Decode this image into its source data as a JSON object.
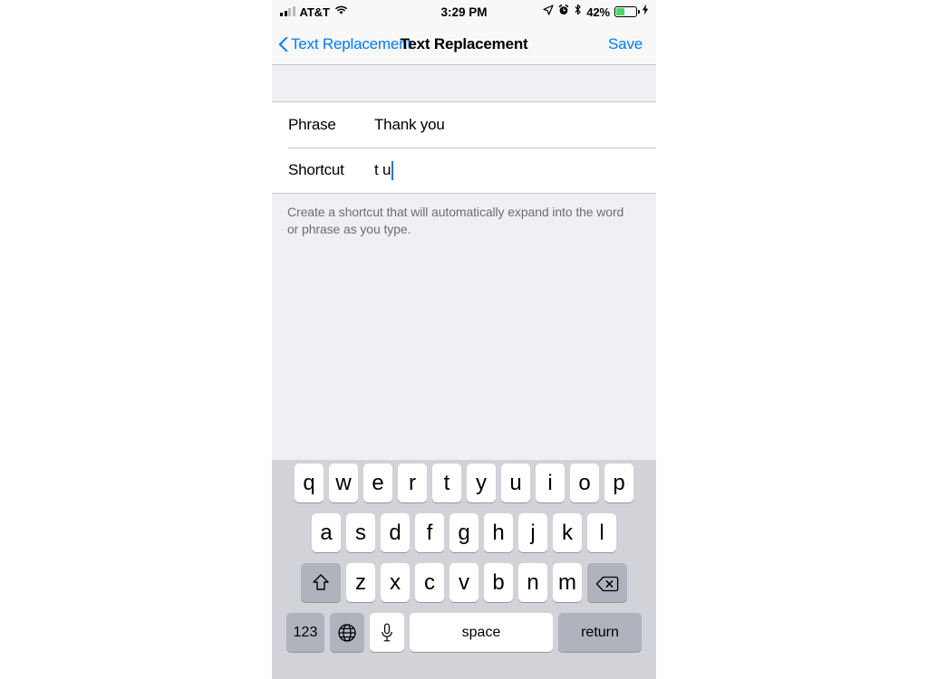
{
  "status_bar": {
    "carrier": "AT&T",
    "time": "3:29 PM",
    "battery_percent": "42%",
    "battery_level": 45,
    "icons": [
      "signal-bars-icon",
      "wifi-icon",
      "location-arrow-icon",
      "alarm-clock-icon",
      "bluetooth-icon",
      "battery-icon",
      "charging-bolt-icon"
    ]
  },
  "nav_bar": {
    "back_label": "Text Replacement",
    "title": "Text Replacement",
    "save_label": "Save"
  },
  "form": {
    "rows": [
      {
        "label": "Phrase",
        "value": "Thank you",
        "focused": false
      },
      {
        "label": "Shortcut",
        "value": "t u",
        "focused": true
      }
    ],
    "footer_note": "Create a shortcut that will automatically expand into the word or phrase as you type."
  },
  "keyboard": {
    "row1": [
      "q",
      "w",
      "e",
      "r",
      "t",
      "y",
      "u",
      "i",
      "o",
      "p"
    ],
    "row2": [
      "a",
      "s",
      "d",
      "f",
      "g",
      "h",
      "j",
      "k",
      "l"
    ],
    "row3": [
      "z",
      "x",
      "c",
      "v",
      "b",
      "n",
      "m"
    ],
    "shift_key": "shift-icon",
    "delete_key": "delete-backspace-icon",
    "numbers_key": "123",
    "globe_key": "globe-icon",
    "dictation_key": "microphone-icon",
    "space_key": "space",
    "return_key": "return"
  },
  "colors": {
    "accent_blue": "#007aff",
    "caret_blue": "#2f6bdd",
    "keyboard_bg": "#d1d3d9",
    "key_white": "#ffffff",
    "key_dark": "#aeb3bd",
    "battery_green": "#4cd764",
    "footer_text": "#6d6d72"
  }
}
